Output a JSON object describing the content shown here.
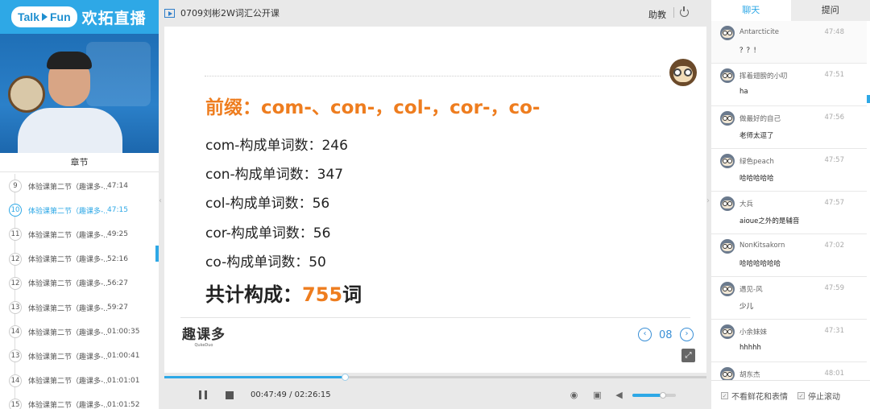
{
  "brand": {
    "logo_en": "Talk",
    "logo_en2": "Fun",
    "logo_cn": "欢拓直播"
  },
  "chapters": {
    "title": "章节",
    "items": [
      {
        "num": "9",
        "name": "体验课第二节（趣课多-...",
        "time": "47:14",
        "active": false
      },
      {
        "num": "10",
        "name": "体验课第二节（趣课多-...",
        "time": "47:15",
        "active": true
      },
      {
        "num": "11",
        "name": "体验课第二节（趣课多-...",
        "time": "49:25",
        "active": false
      },
      {
        "num": "12",
        "name": "体验课第二节（趣课多-...",
        "time": "52:16",
        "active": false
      },
      {
        "num": "12",
        "name": "体验课第二节（趣课多-...",
        "time": "56:27",
        "active": false
      },
      {
        "num": "13",
        "name": "体验课第二节（趣课多-...",
        "time": "59:27",
        "active": false
      },
      {
        "num": "14",
        "name": "体验课第二节（趣课多-...",
        "time": "01:00:35",
        "active": false
      },
      {
        "num": "13",
        "name": "体验课第二节（趣课多-...",
        "time": "01:00:41",
        "active": false
      },
      {
        "num": "14",
        "name": "体验课第二节（趣课多-...",
        "time": "01:01:01",
        "active": false
      },
      {
        "num": "15",
        "name": "体验课第二节（趣课多-...",
        "time": "01:01:52",
        "active": false
      }
    ]
  },
  "player": {
    "title": "0709刘彬2W词汇公开课",
    "assist_label": "助教",
    "slide": {
      "heading": "前缀：com-、con-，col-，cor-，co-",
      "lines": [
        "com-构成单词数：246",
        "con-构成单词数：347",
        "col-构成单词数：56",
        "cor-构成单词数：56",
        "co-构成单词数：50"
      ],
      "total_prefix": "共计构成：",
      "total_value": "755",
      "total_suffix": "词",
      "brand": "趣课多",
      "brand_sub": "QukeDuo",
      "page": "08"
    },
    "time_current": "00:47:49",
    "time_sep": " / ",
    "time_total": "02:26:15",
    "progress": 0.335,
    "volume": 0.7
  },
  "chat": {
    "tabs": [
      "聊天",
      "提问"
    ],
    "messages": [
      {
        "user": "Antarcticite",
        "time": "47:48",
        "text": "？？！"
      },
      {
        "user": "挥着翅膀的小叨",
        "time": "47:51",
        "text": "ha"
      },
      {
        "user": "做最好的自己",
        "time": "47:56",
        "text": "老师太逗了"
      },
      {
        "user": "绿色peach",
        "time": "47:57",
        "text": "哈哈哈哈哈"
      },
      {
        "user": "大兵",
        "time": "47:57",
        "text": "aioue之外的是辅音"
      },
      {
        "user": "NonKitsakorn",
        "time": "47:02",
        "text": "哈哈哈哈哈哈"
      },
      {
        "user": "遇见-风",
        "time": "47:59",
        "text": "少儿"
      },
      {
        "user": "小余妹妹",
        "time": "47:31",
        "text": "hhhhh"
      },
      {
        "user": "胡东杰",
        "time": "48:01",
        "text": ""
      }
    ],
    "footer": {
      "hide_flowers": "不看鲜花和表情",
      "stop_scroll": "停止滚动"
    }
  },
  "colors": {
    "accent": "#2ea8e6",
    "orange": "#ee7d1f"
  }
}
